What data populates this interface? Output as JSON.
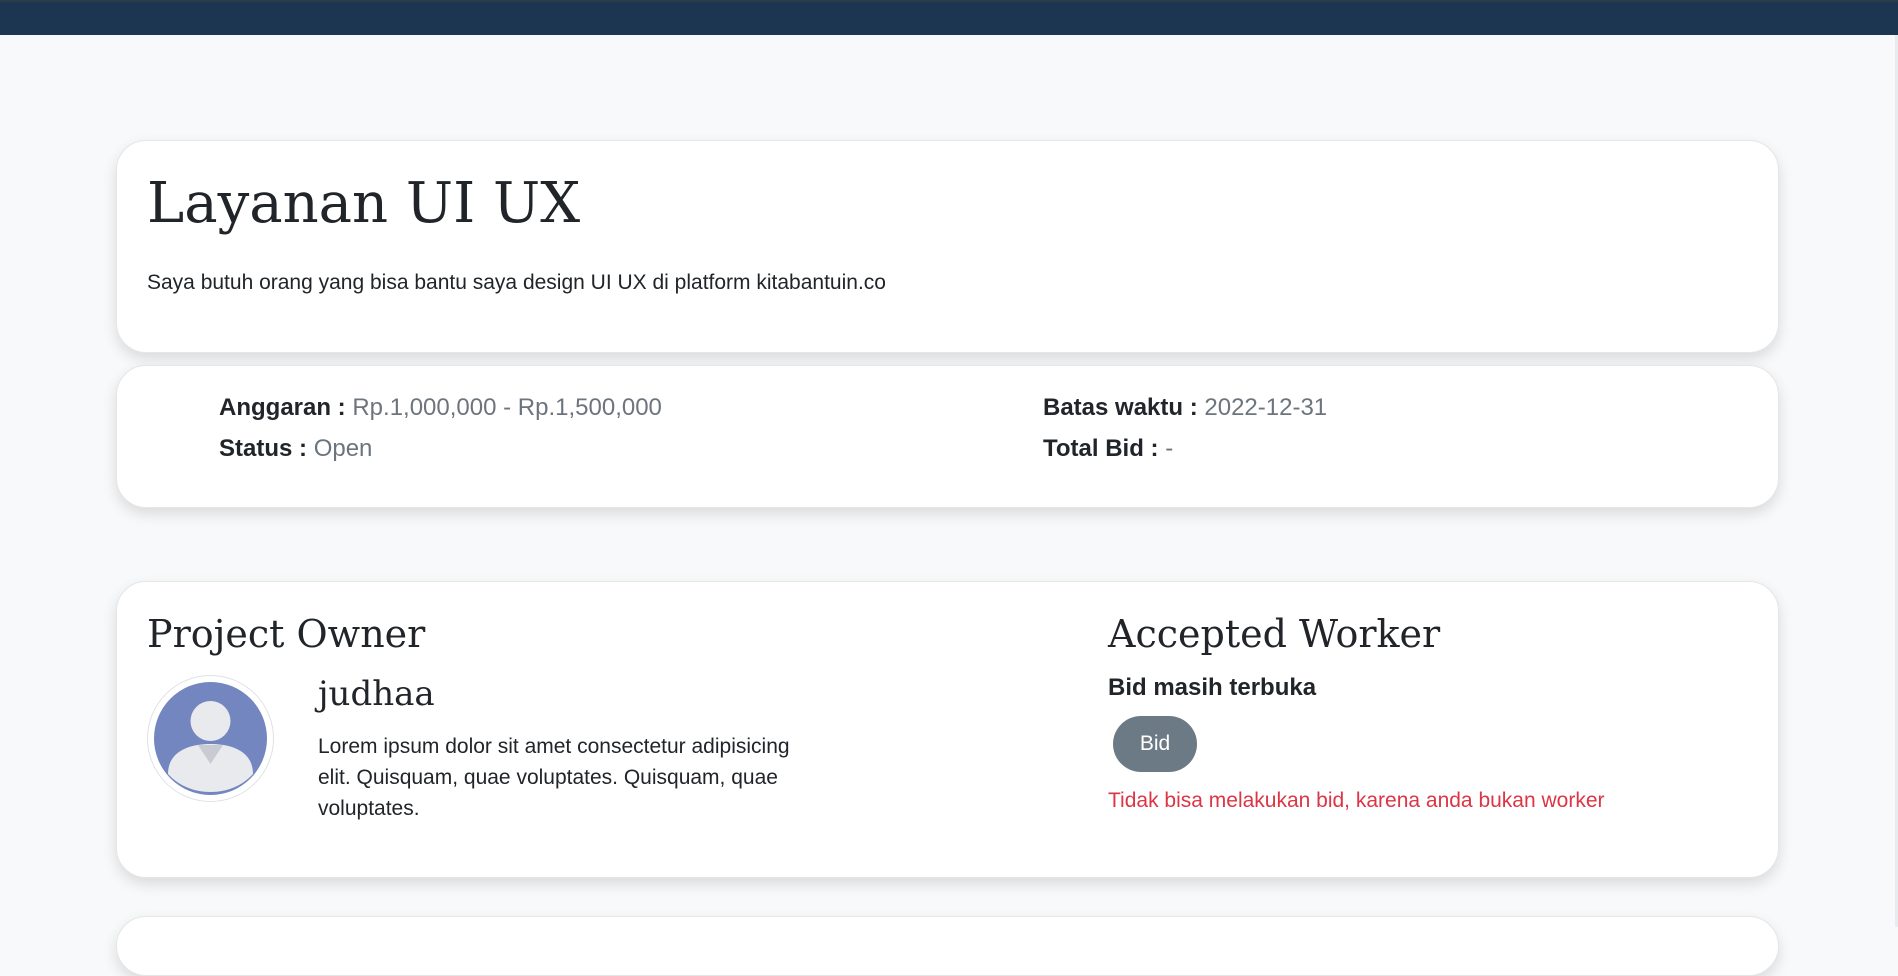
{
  "project": {
    "title": "Layanan UI UX",
    "description": "Saya butuh orang yang bisa bantu saya design UI UX di platform kitabantuin.co"
  },
  "info": {
    "budget_label": "Anggaran :",
    "budget_value": "Rp.1,000,000 - Rp.1,500,000",
    "deadline_label": "Batas waktu :",
    "deadline_value": "2022-12-31",
    "status_label": "Status :",
    "status_value": "Open",
    "total_bid_label": "Total Bid :",
    "total_bid_value": "-"
  },
  "owner": {
    "heading": "Project Owner",
    "name": "judhaa",
    "bio": "Lorem ipsum dolor sit amet consectetur adipisicing elit. Quisquam, quae voluptates. Quisquam, quae voluptates.",
    "avatar_icon": "user-avatar-icon"
  },
  "worker": {
    "heading": "Accepted Worker",
    "bid_status": "Bid masih terbuka",
    "bid_button": "Bid",
    "error_message": "Tidak bisa melakukan bid, karena anda bukan worker"
  },
  "colors": {
    "navbar": "#1c3652",
    "button": "#6c7a86",
    "error": "#dc3545",
    "muted": "#6c757d"
  }
}
